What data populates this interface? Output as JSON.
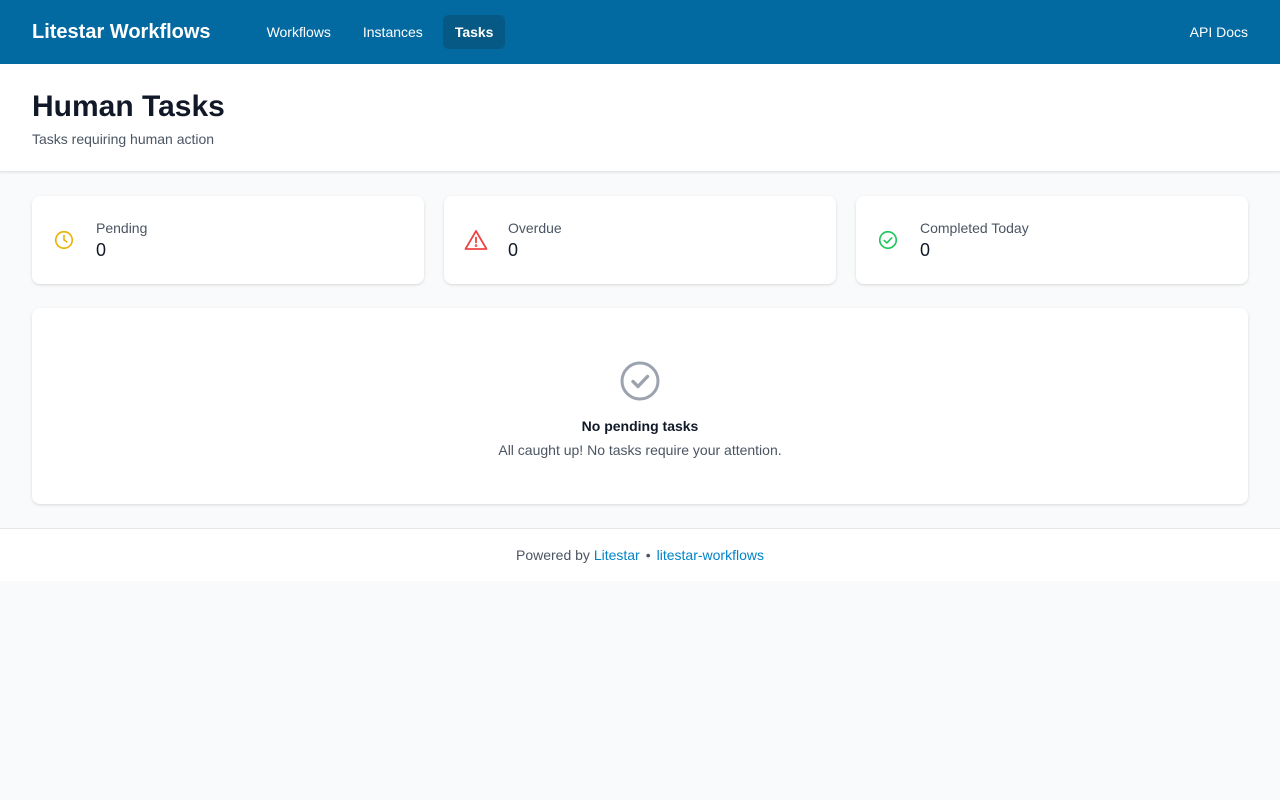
{
  "header": {
    "brand": "Litestar Workflows",
    "nav": [
      {
        "label": "Workflows",
        "active": false
      },
      {
        "label": "Instances",
        "active": false
      },
      {
        "label": "Tasks",
        "active": true
      }
    ],
    "api_docs": "API Docs",
    "bg_color": "#0369a1",
    "active_tab_color": "#075985"
  },
  "page": {
    "title": "Human Tasks",
    "subtitle": "Tasks requiring human action"
  },
  "stats": [
    {
      "label": "Pending",
      "value": "0",
      "icon": "clock-icon",
      "color": "#eab308"
    },
    {
      "label": "Overdue",
      "value": "0",
      "icon": "warning-triangle-icon",
      "color": "#ef4444"
    },
    {
      "label": "Completed Today",
      "value": "0",
      "icon": "check-circle-icon",
      "color": "#22c55e"
    }
  ],
  "empty_state": {
    "icon": "check-circle-icon",
    "title": "No pending tasks",
    "description": "All caught up! No tasks require your attention."
  },
  "footer": {
    "prefix": "Powered by",
    "link1": "Litestar",
    "separator": "•",
    "link2": "litestar-workflows",
    "link_color": "#0284c7"
  }
}
